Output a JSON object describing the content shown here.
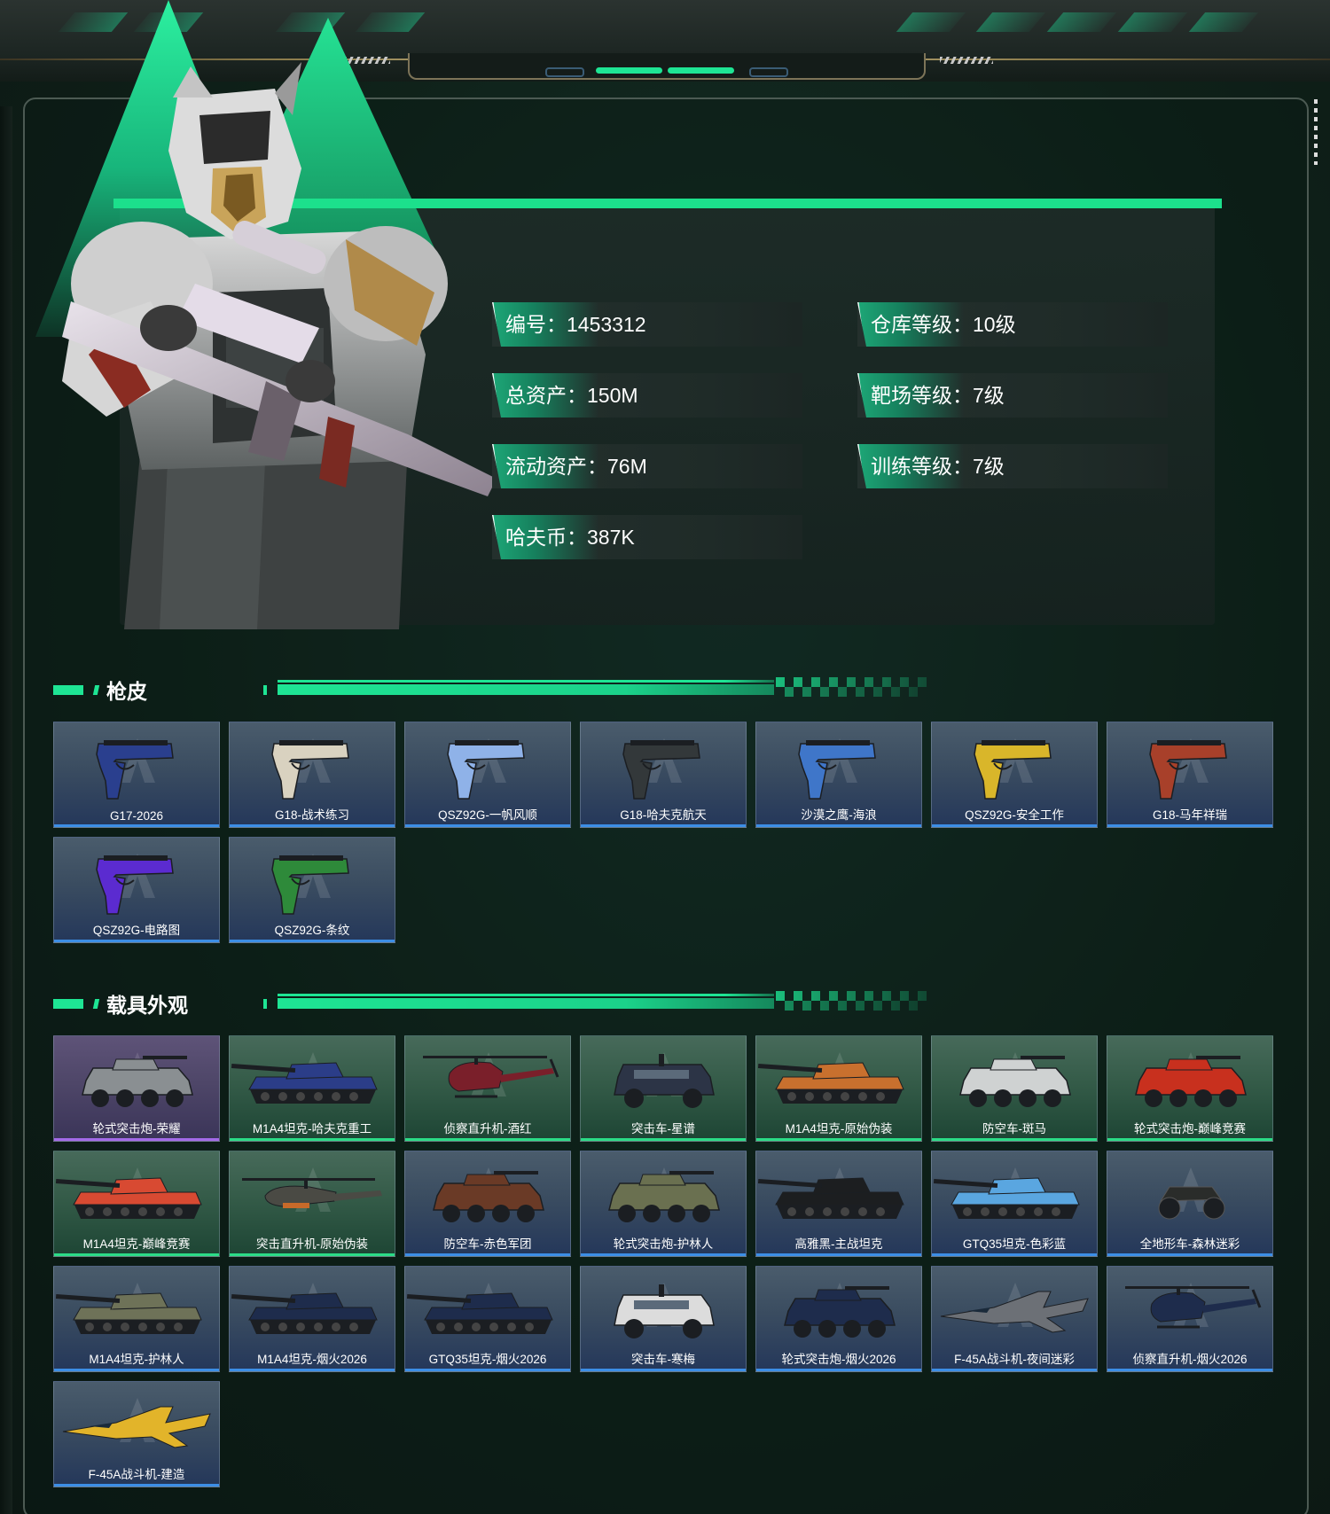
{
  "profile": {
    "stats": [
      {
        "label": "编号：1453312"
      },
      {
        "label": "仓库等级：10级"
      },
      {
        "label": "总资产：150M"
      },
      {
        "label": "靶场等级：7级"
      },
      {
        "label": "流动资产：76M"
      },
      {
        "label": "训练等级：7级"
      },
      {
        "label": "哈夫币：387K"
      }
    ]
  },
  "sections": {
    "weapon_skins": {
      "title": "枪皮",
      "items": [
        {
          "name": "G17-2026",
          "rarity": "blue",
          "icon": "pistol-icon",
          "color": "#2a3f8e"
        },
        {
          "name": "G18-战术练习",
          "rarity": "blue",
          "icon": "pistol-icon",
          "color": "#d9d2c0"
        },
        {
          "name": "QSZ92G-一帆风顺",
          "rarity": "blue",
          "icon": "pistol-icon",
          "color": "#8fb2e8"
        },
        {
          "name": "G18-哈夫克航天",
          "rarity": "blue",
          "icon": "pistol-icon",
          "color": "#33383a"
        },
        {
          "name": "沙漠之鹰-海浪",
          "rarity": "blue",
          "icon": "pistol-icon",
          "color": "#3f76c9"
        },
        {
          "name": "QSZ92G-安全工作",
          "rarity": "blue",
          "icon": "pistol-icon",
          "color": "#d9b62a"
        },
        {
          "name": "G18-马年祥瑞",
          "rarity": "blue",
          "icon": "pistol-icon",
          "color": "#a8402a"
        },
        {
          "name": "QSZ92G-电路图",
          "rarity": "blue",
          "icon": "pistol-icon",
          "color": "#5b2bd0"
        },
        {
          "name": "QSZ92G-条纹",
          "rarity": "blue",
          "icon": "pistol-icon",
          "color": "#2e8a3a"
        }
      ]
    },
    "vehicle_skins": {
      "title": "载具外观",
      "items": [
        {
          "name": "轮式突击炮-荣耀",
          "rarity": "purple",
          "icon": "armored-car-icon",
          "color": "#8a8f92"
        },
        {
          "name": "M1A4坦克-哈夫克重工",
          "rarity": "green",
          "icon": "tank-icon",
          "color": "#2b3d88"
        },
        {
          "name": "侦察直升机-酒红",
          "rarity": "green",
          "icon": "helicopter-icon",
          "color": "#7a1f2a"
        },
        {
          "name": "突击车-星谱",
          "rarity": "green",
          "icon": "assault-vehicle-icon",
          "color": "#2c3446"
        },
        {
          "name": "M1A4坦克-原始伪装",
          "rarity": "green",
          "icon": "tank-icon",
          "color": "#c8702e"
        },
        {
          "name": "防空车-斑马",
          "rarity": "green",
          "icon": "armored-car-icon",
          "color": "#cfd2d2"
        },
        {
          "name": "轮式突击炮-巅峰竞赛",
          "rarity": "green",
          "icon": "armored-car-icon",
          "color": "#c8301e"
        },
        {
          "name": "M1A4坦克-巅峰竞赛",
          "rarity": "green",
          "icon": "tank-icon",
          "color": "#d84a32"
        },
        {
          "name": "突击直升机-原始伪装",
          "rarity": "green",
          "icon": "attack-helicopter-icon",
          "color": "#4a4a44"
        },
        {
          "name": "防空车-赤色军团",
          "rarity": "blue",
          "icon": "armored-car-icon",
          "color": "#6a3a26"
        },
        {
          "name": "轮式突击炮-护林人",
          "rarity": "blue",
          "icon": "armored-car-icon",
          "color": "#6a7050"
        },
        {
          "name": "高雅黑-主战坦克",
          "rarity": "blue",
          "icon": "tank-icon",
          "color": "#1c1e20"
        },
        {
          "name": "GTQ35坦克-色彩蓝",
          "rarity": "blue",
          "icon": "tank-icon",
          "color": "#5aa6e0"
        },
        {
          "name": "全地形车-森林迷彩",
          "rarity": "blue",
          "icon": "atv-icon",
          "color": "#2a2c2a"
        },
        {
          "name": "M1A4坦克-护林人",
          "rarity": "blue",
          "icon": "tank-icon",
          "color": "#6e7258"
        },
        {
          "name": "M1A4坦克-烟火2026",
          "rarity": "blue",
          "icon": "tank-icon",
          "color": "#1e2c4c"
        },
        {
          "name": "GTQ35坦克-烟火2026",
          "rarity": "blue",
          "icon": "tank-icon",
          "color": "#1e2c4c"
        },
        {
          "name": "突击车-寒梅",
          "rarity": "blue",
          "icon": "assault-vehicle-icon",
          "color": "#dcdcdc"
        },
        {
          "name": "轮式突击炮-烟火2026",
          "rarity": "blue",
          "icon": "armored-car-icon",
          "color": "#1e2c4c"
        },
        {
          "name": "F-45A战斗机-夜间迷彩",
          "rarity": "blue",
          "icon": "fighter-jet-icon",
          "color": "#6c7076"
        },
        {
          "name": "侦察直升机-烟火2026",
          "rarity": "blue",
          "icon": "helicopter-icon",
          "color": "#1e2c4c"
        },
        {
          "name": "F-45A战斗机-建造",
          "rarity": "blue",
          "icon": "fighter-jet-icon",
          "color": "#e2b42a"
        }
      ]
    }
  },
  "colors": {
    "accent": "#1ee594",
    "rarity_blue": "#3c8ee6",
    "rarity_green": "#2bdc87",
    "rarity_purple": "#a36ae8"
  }
}
